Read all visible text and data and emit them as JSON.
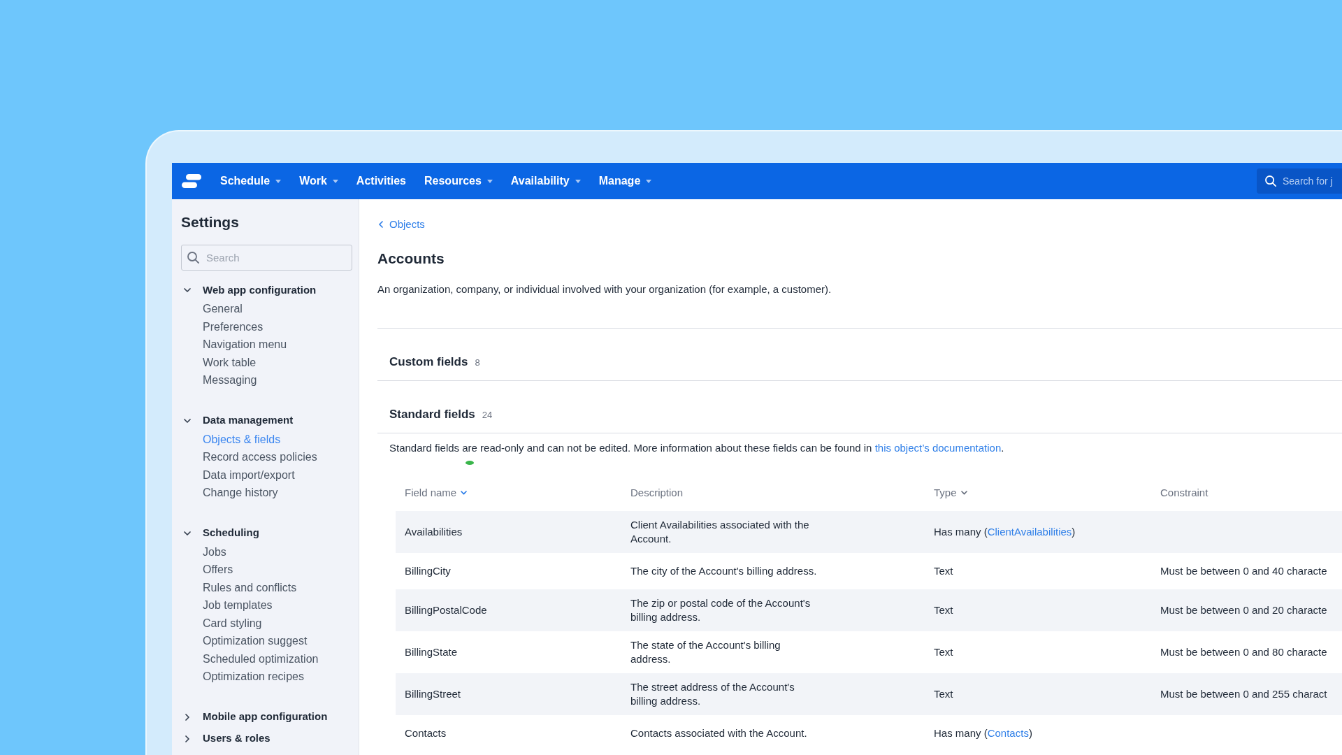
{
  "nav": {
    "items": [
      {
        "label": "Schedule",
        "dropdown": true
      },
      {
        "label": "Work",
        "dropdown": true
      },
      {
        "label": "Activities",
        "dropdown": false
      },
      {
        "label": "Resources",
        "dropdown": true
      },
      {
        "label": "Availability",
        "dropdown": true
      },
      {
        "label": "Manage",
        "dropdown": true
      }
    ],
    "search": {
      "placeholder": "Search for j"
    }
  },
  "sidebar": {
    "title": "Settings",
    "search": {
      "placeholder": "Search"
    },
    "sections": [
      {
        "label": "Web app configuration",
        "expanded": true,
        "items": [
          {
            "label": "General",
            "selected": false
          },
          {
            "label": "Preferences",
            "selected": false
          },
          {
            "label": "Navigation menu",
            "selected": false
          },
          {
            "label": "Work table",
            "selected": false
          },
          {
            "label": "Messaging",
            "selected": false
          }
        ]
      },
      {
        "label": "Data management",
        "expanded": true,
        "items": [
          {
            "label": "Objects & fields",
            "selected": true
          },
          {
            "label": "Record access policies",
            "selected": false
          },
          {
            "label": "Data import/export",
            "selected": false
          },
          {
            "label": "Change history",
            "selected": false
          }
        ]
      },
      {
        "label": "Scheduling",
        "expanded": true,
        "items": [
          {
            "label": "Jobs",
            "selected": false
          },
          {
            "label": "Offers",
            "selected": false
          },
          {
            "label": "Rules and conflicts",
            "selected": false
          },
          {
            "label": "Job templates",
            "selected": false
          },
          {
            "label": "Card styling",
            "selected": false
          },
          {
            "label": "Optimization suggest",
            "selected": false
          },
          {
            "label": "Scheduled optimization",
            "selected": false
          },
          {
            "label": "Optimization recipes",
            "selected": false
          }
        ]
      },
      {
        "label": "Mobile app configuration",
        "expanded": false
      },
      {
        "label": "Users & roles",
        "expanded": false
      }
    ]
  },
  "main": {
    "breadcrumb": "Objects",
    "title": "Accounts",
    "description": "An organization, company, or individual involved with your organization (for example, a customer).",
    "sections": [
      {
        "label": "Custom fields",
        "count": "8"
      },
      {
        "label": "Standard fields",
        "count": "24",
        "info": {
          "text": "Standard fields are read-only and can not be edited. More information about these fields can be found in ",
          "link": "this object’s documentation",
          "after": "."
        },
        "table": {
          "columns": [
            {
              "label": "Field name",
              "sortable": true,
              "sorted": true
            },
            {
              "label": "Description",
              "sortable": false,
              "sorted": false
            },
            {
              "label": "Type",
              "sortable": true,
              "sorted": false
            },
            {
              "label": "Constraint",
              "sortable": false,
              "sorted": false
            }
          ],
          "rows": [
            {
              "field_name": "Availabilities",
              "description": "Client Availabilities associated with the Account.",
              "type": {
                "text": "Has many (",
                "link": "ClientAvailabilities",
                "after": ")"
              }
            },
            {
              "field_name": "BillingCity",
              "description": "The city of the Account's billing address.",
              "type": {
                "text": "Text"
              },
              "constraint": "Must be between 0 and 40 characte"
            },
            {
              "field_name": "BillingPostalCode",
              "description": "The zip or postal code of the Account's billing address.",
              "type": {
                "text": "Text"
              },
              "constraint": "Must be between 0 and 20 characte"
            },
            {
              "field_name": "BillingState",
              "description": "The state of the Account's billing address.",
              "type": {
                "text": "Text"
              },
              "constraint": "Must be between 0 and 80 characte"
            },
            {
              "field_name": "BillingStreet",
              "description": "The street address of the Account's billing address.",
              "type": {
                "text": "Text"
              },
              "constraint": "Must be between 0 and 255 charact"
            },
            {
              "field_name": "Contacts",
              "description": "Contacts associated with the Account.",
              "type": {
                "text": "Has many (",
                "link": "Contacts",
                "after": ")"
              }
            }
          ]
        }
      }
    ]
  }
}
